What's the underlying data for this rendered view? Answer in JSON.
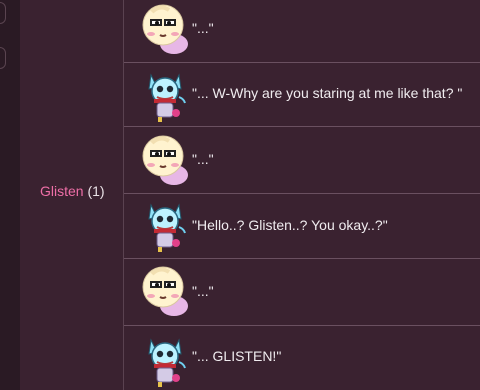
{
  "speaker": {
    "name": "Glisten",
    "count": "(1)"
  },
  "messages": [
    {
      "text": "\"...\"",
      "avatar": "cream-blob-avatar"
    },
    {
      "text": "\"... W-Why are you staring at me like that? \"",
      "avatar": "blue-cat-avatar"
    },
    {
      "text": "\"...\"",
      "avatar": "cream-blob-avatar"
    },
    {
      "text": "\"Hello..? Glisten..? You okay..?\"",
      "avatar": "blue-cat-avatar"
    },
    {
      "text": "\"...\"",
      "avatar": "cream-blob-avatar"
    },
    {
      "text": "\"... GLISTEN!\"",
      "avatar": "blue-cat-avatar"
    }
  ],
  "colors": {
    "background": "#3a2230",
    "speaker_name": "#ee6fa7",
    "text": "#f0ecef"
  }
}
